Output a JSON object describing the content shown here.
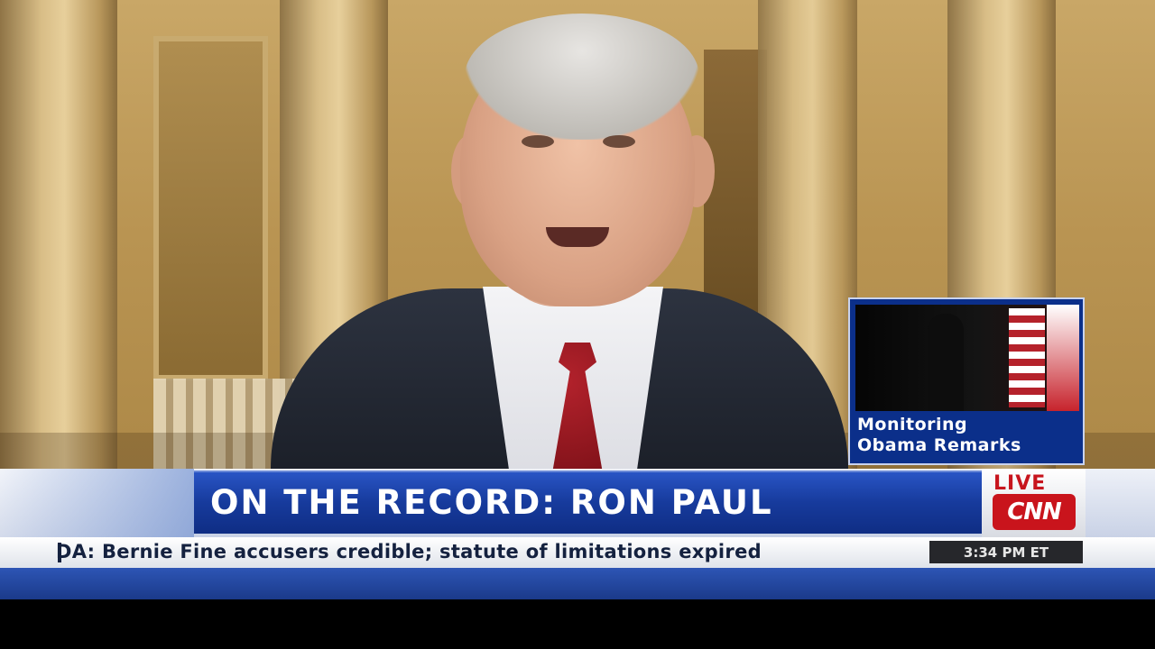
{
  "inset": {
    "label_line1": "Monitoring",
    "label_line2": "Obama Remarks"
  },
  "lower_third": {
    "headline": "ON THE RECORD: RON PAUL",
    "live_label": "LIVE",
    "network_logo": "CNN"
  },
  "ticker": {
    "text": "DA: Bernie Fine accusers credible; statute of limitations expired",
    "time": "3:34 PM ET"
  },
  "colors": {
    "headline_bg": "#173b9d",
    "logo_red": "#c9141c",
    "ticker_text": "#14213f"
  }
}
